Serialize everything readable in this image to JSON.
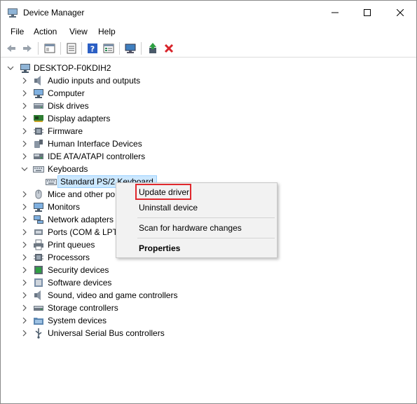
{
  "window": {
    "title": "Device Manager"
  },
  "menu": [
    "File",
    "Action",
    "View",
    "Help"
  ],
  "tree": {
    "root": "DESKTOP-F0KDIH2",
    "categories": [
      {
        "label": "Audio inputs and outputs",
        "icon": "speaker-icon"
      },
      {
        "label": "Computer",
        "icon": "monitor-icon"
      },
      {
        "label": "Disk drives",
        "icon": "disk-icon"
      },
      {
        "label": "Display adapters",
        "icon": "display-adapter-icon"
      },
      {
        "label": "Firmware",
        "icon": "chip-icon"
      },
      {
        "label": "Human Interface Devices",
        "icon": "hid-icon"
      },
      {
        "label": "IDE ATA/ATAPI controllers",
        "icon": "ide-icon"
      },
      {
        "label": "Keyboards",
        "icon": "keyboard-icon",
        "expanded": true
      },
      {
        "label": "Standard PS/2 Keyboard",
        "icon": "keyboard-icon",
        "child": true,
        "selected": true
      },
      {
        "label": "Mice and other po",
        "icon": "mouse-icon"
      },
      {
        "label": "Monitors",
        "icon": "monitor-icon"
      },
      {
        "label": "Network adapters",
        "icon": "network-icon"
      },
      {
        "label": "Ports (COM & LPT",
        "icon": "port-icon"
      },
      {
        "label": "Print queues",
        "icon": "printer-icon"
      },
      {
        "label": "Processors",
        "icon": "chip-icon"
      },
      {
        "label": "Security devices",
        "icon": "security-icon"
      },
      {
        "label": "Software devices",
        "icon": "software-icon"
      },
      {
        "label": "Sound, video and game controllers",
        "icon": "speaker-icon"
      },
      {
        "label": "Storage controllers",
        "icon": "storage-icon"
      },
      {
        "label": "System devices",
        "icon": "folder-icon"
      },
      {
        "label": "Universal Serial Bus controllers",
        "icon": "usb-icon"
      }
    ]
  },
  "context_menu": {
    "items": [
      "Update driver",
      "Uninstall device",
      "Scan for hardware changes",
      "Properties"
    ],
    "highlight_color": "#e0282d"
  },
  "colors": {
    "selection_bg": "#cce8ff",
    "selection_border": "#99d1ff"
  }
}
